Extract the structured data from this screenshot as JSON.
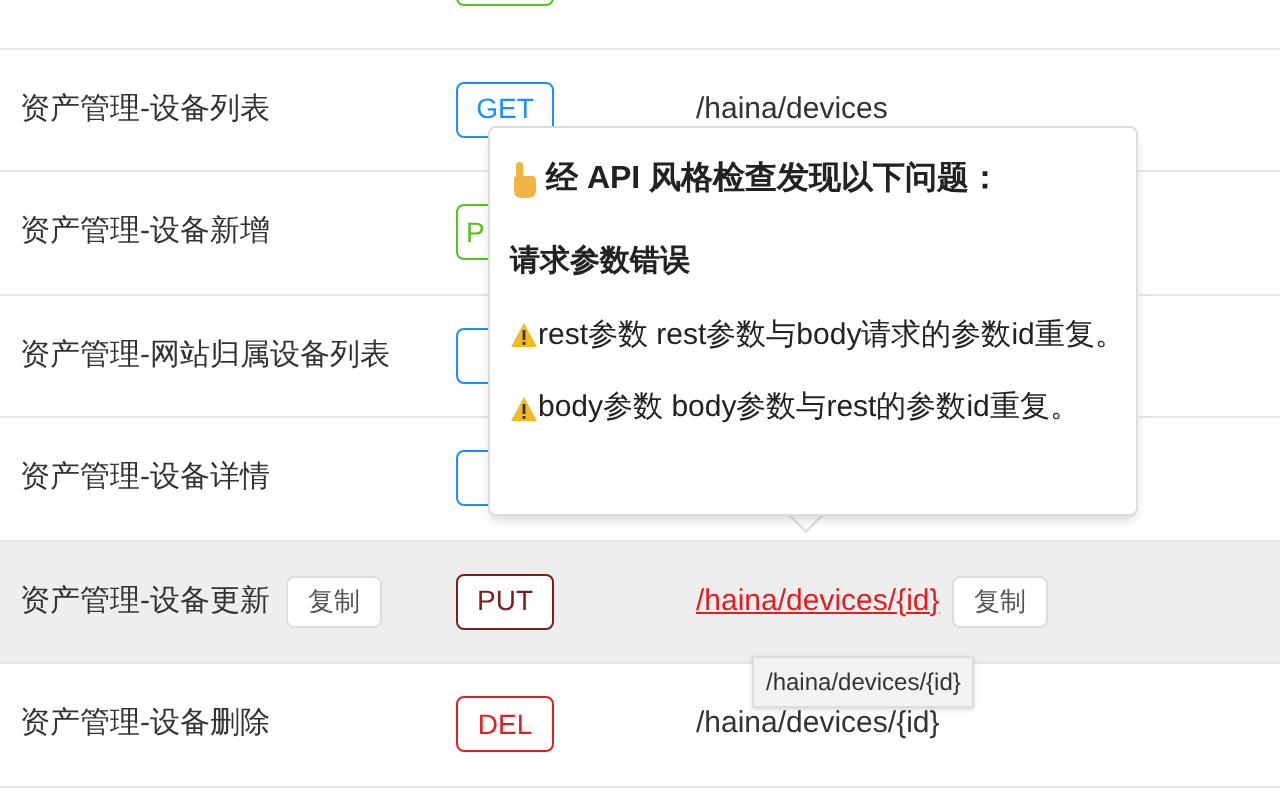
{
  "rows": [
    {
      "name": "",
      "method": "",
      "color": "#52c41a",
      "path": "",
      "cut": true,
      "selected": false
    },
    {
      "name": "资产管理-设备列表",
      "method": "GET",
      "color": "#1890ff",
      "path": "/haina/devices",
      "selected": false
    },
    {
      "name": "资产管理-设备新增",
      "method": "P",
      "color": "#52c41a",
      "path": "",
      "cut": true,
      "selected": false
    },
    {
      "name": "资产管理-网站归属设备列表",
      "method": "",
      "color": "#1890ff",
      "path": "",
      "cut": true,
      "selected": false
    },
    {
      "name": "资产管理-设备详情",
      "method": "",
      "color": "#1890ff",
      "path": "",
      "cut": true,
      "selected": false
    },
    {
      "name": "资产管理-设备更新",
      "method": "PUT",
      "color": "#7a1f1f",
      "path": "/haina/devices/{id}",
      "selected": true,
      "copy": "复制",
      "path_copy": "复制",
      "tooltip": "/haina/devices/{id}"
    },
    {
      "name": "资产管理-设备删除",
      "method": "DEL",
      "color": "#e02020",
      "path": "/haina/devices/{id}",
      "selected": false
    }
  ],
  "popover": {
    "title": "经 API 风格检查发现以下问题：",
    "section": "请求参数错误",
    "warnings": [
      "rest参数 rest参数与body请求的参数id重复。",
      "body参数 body参数与rest的参数id重复。"
    ]
  }
}
